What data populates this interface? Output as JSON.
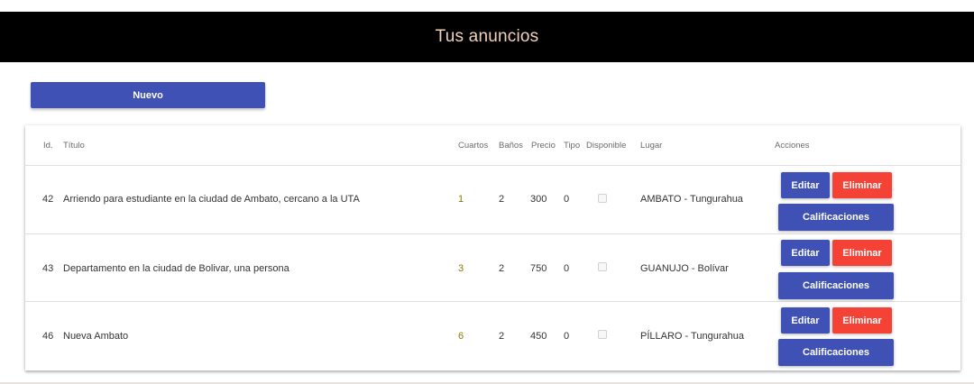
{
  "header": {
    "title": "Tus anuncios"
  },
  "toolbar": {
    "new_label": "Nuevo"
  },
  "table": {
    "columns": {
      "id": "Id.",
      "title": "Título",
      "rooms": "Cuartos",
      "baths": "Baños",
      "price": "Precio",
      "type": "Tipo",
      "available": "Disponible",
      "place": "Lugar",
      "actions": "Acciones"
    },
    "rows": [
      {
        "id": "42",
        "title": "Arriendo para estudiante en la ciudad de Ambato, cercano a la UTA",
        "rooms": "1",
        "baths": "2",
        "price": "300",
        "type": "0",
        "available": false,
        "place": "AMBATO - Tungurahua"
      },
      {
        "id": "43",
        "title": "Departamento en la ciudad de Bolivar, una persona",
        "rooms": "3",
        "baths": "2",
        "price": "750",
        "type": "0",
        "available": false,
        "place": "GUANUJO - Bolívar"
      },
      {
        "id": "46",
        "title": "Nueva Ambato",
        "rooms": "6",
        "baths": "2",
        "price": "450",
        "type": "0",
        "available": false,
        "place": "PÍLLARO - Tungurahua"
      }
    ]
  },
  "actions": {
    "edit_label": "Editar",
    "delete_label": "Eliminar",
    "ratings_label": "Calificaciones"
  },
  "colors": {
    "header_bg": "#000000",
    "header_text": "#f1d2bb",
    "primary": "#3f51b5",
    "danger": "#f44336"
  }
}
